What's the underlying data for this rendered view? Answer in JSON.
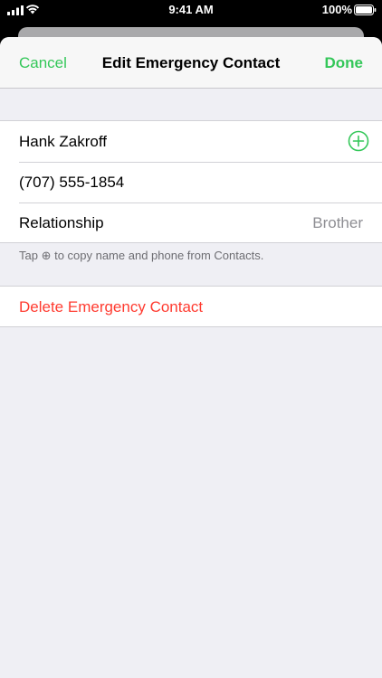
{
  "status_bar": {
    "time": "9:41 AM",
    "battery": "100%"
  },
  "nav": {
    "cancel_label": "Cancel",
    "title": "Edit Emergency Contact",
    "done_label": "Done"
  },
  "contact": {
    "name": "Hank Zakroff",
    "phone": "(707) 555-1854",
    "relationship_label": "Relationship",
    "relationship_value": "Brother"
  },
  "footer_note": "Tap ⊕ to copy name and phone from Contacts.",
  "delete_label": "Delete Emergency Contact",
  "colors": {
    "accent": "#34c759",
    "destructive": "#ff3b30",
    "background": "#efeff4"
  },
  "icons": [
    "cellular-signal-icon",
    "wifi-icon",
    "battery-icon",
    "add-circle-icon"
  ]
}
